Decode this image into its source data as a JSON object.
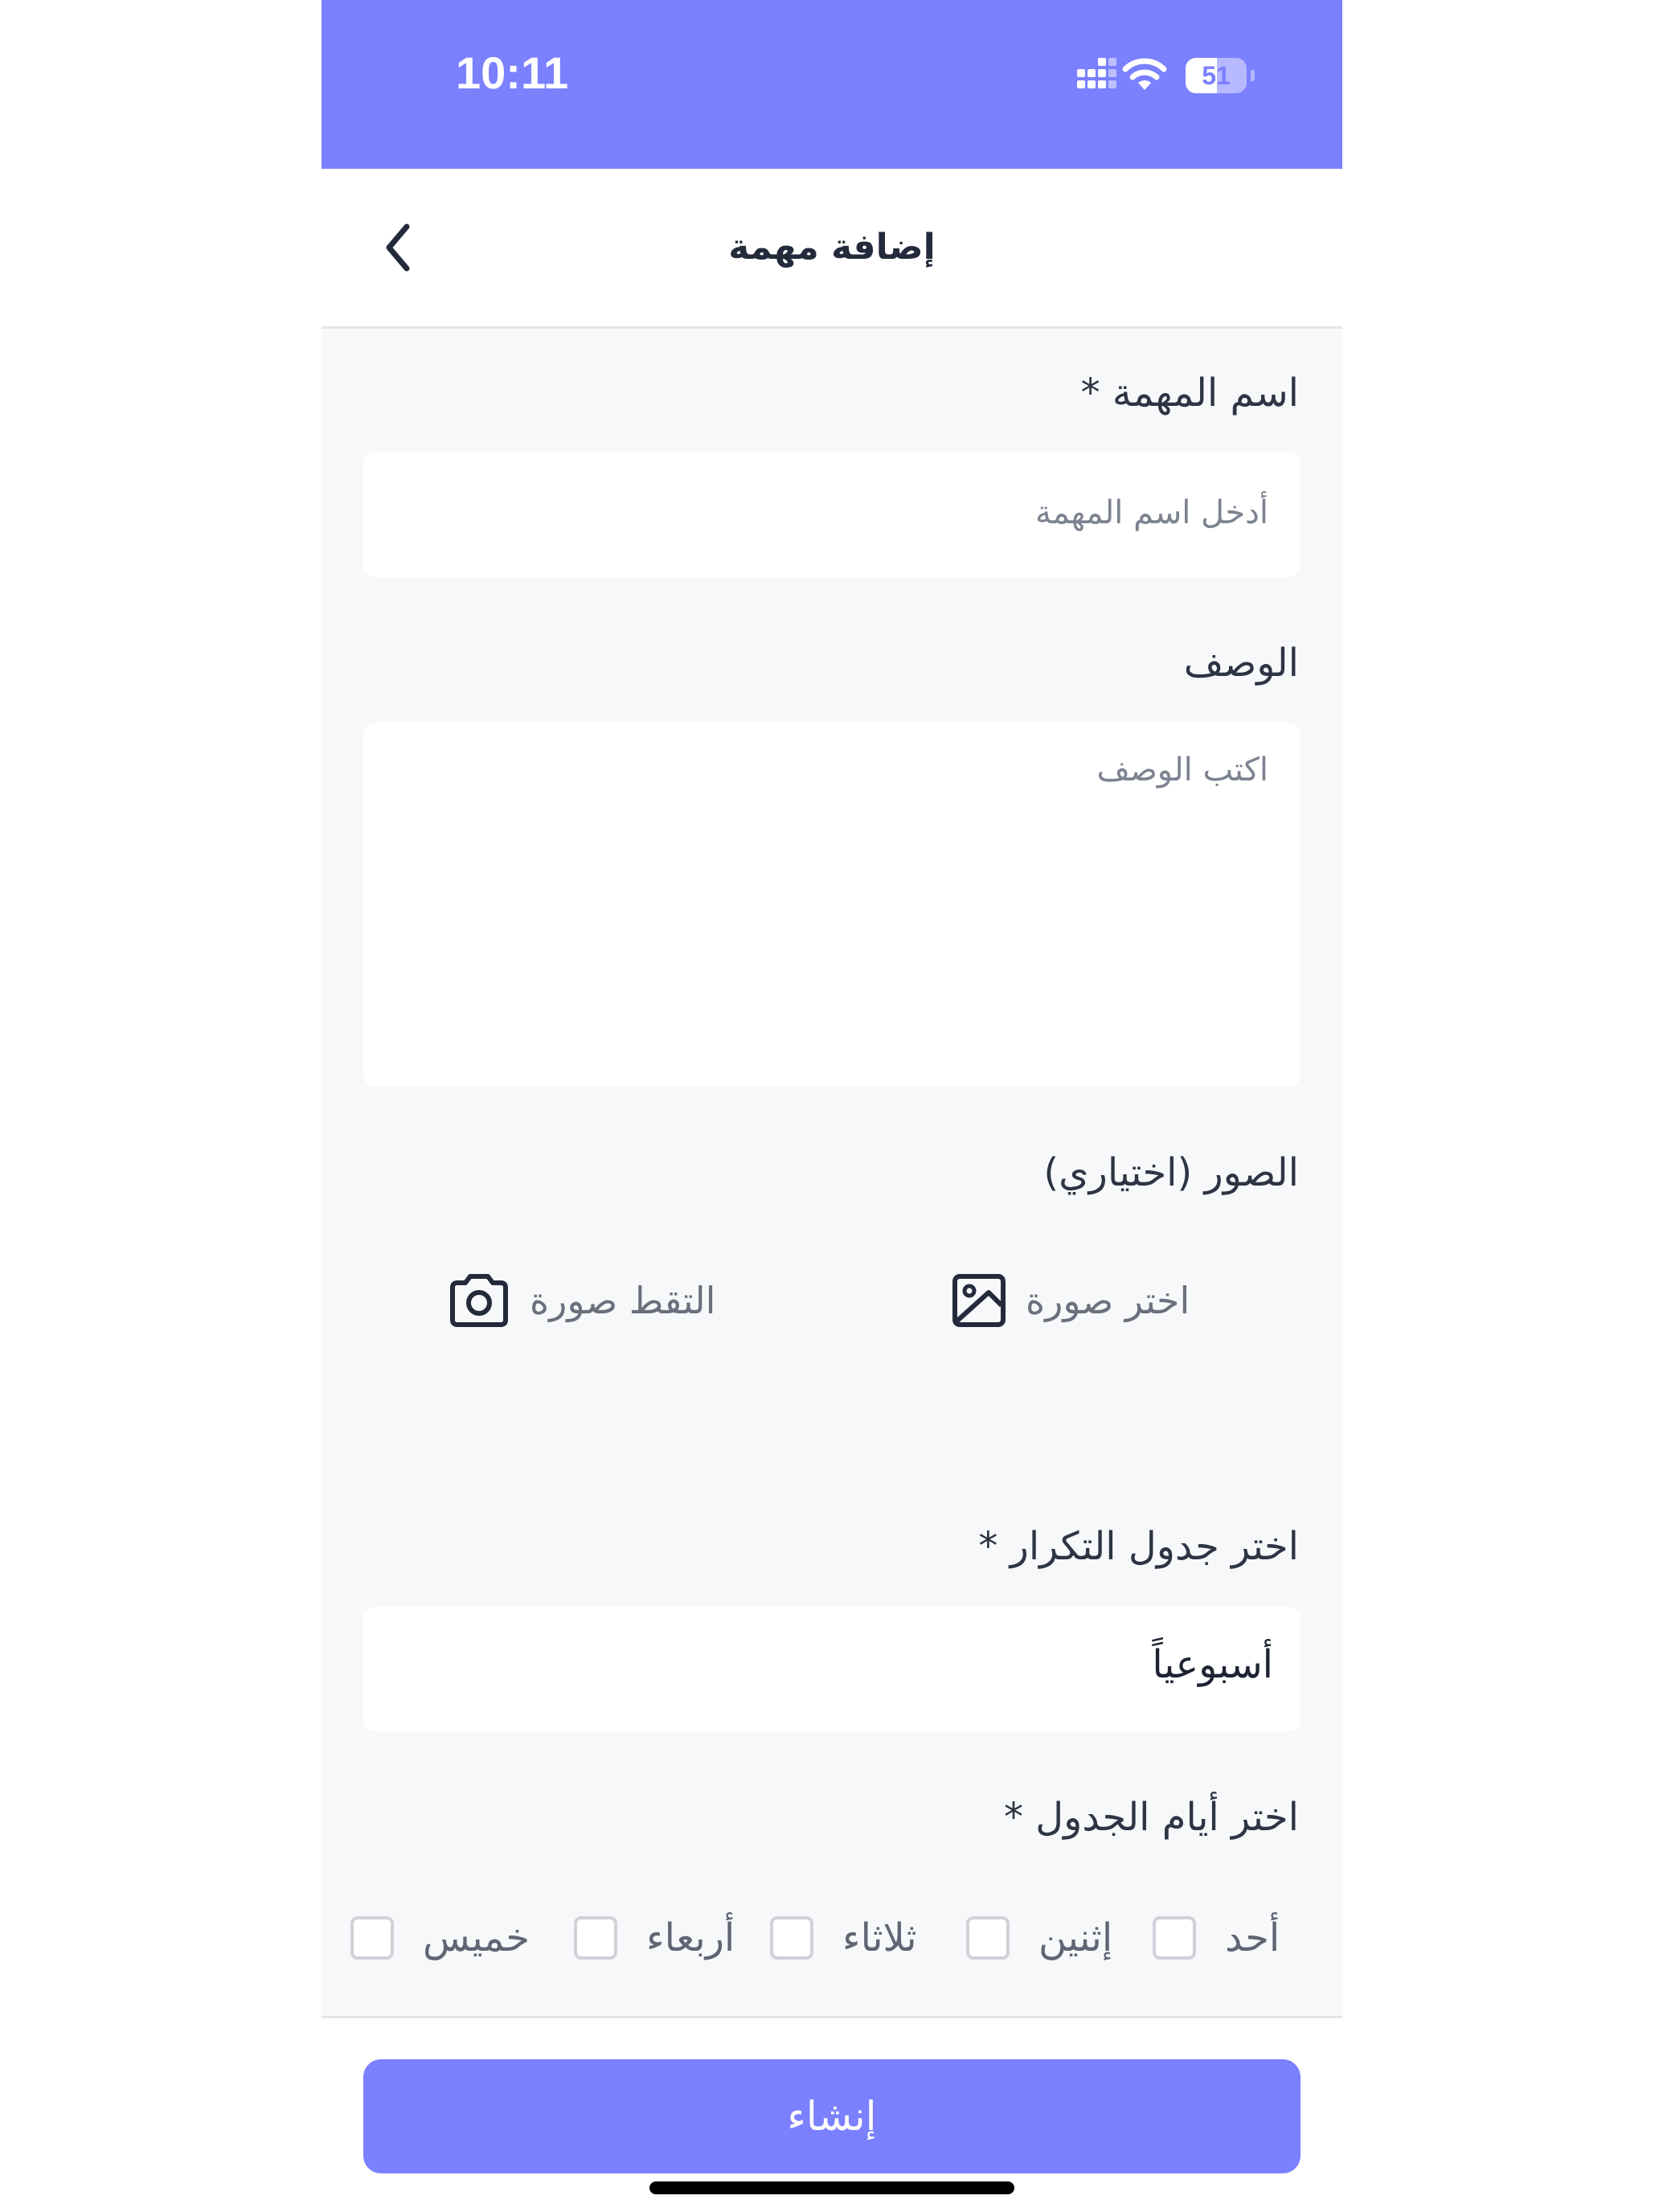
{
  "status_bar": {
    "time": "10:11",
    "battery_level": "51",
    "battery_fraction": 0.51,
    "background_color": "#7b80ff",
    "signal_icon": "cellular-signal-icon",
    "wifi_icon": "wifi-icon",
    "battery_icon": "battery-icon"
  },
  "header": {
    "title": "إضافة مهمة",
    "back_icon": "chevron-left-icon"
  },
  "form": {
    "task_name": {
      "label": "اسم المهمة *",
      "placeholder": "أدخل اسم المهمة",
      "value": ""
    },
    "description": {
      "label": "الوصف",
      "placeholder": "اكتب الوصف",
      "value": ""
    },
    "photos": {
      "label": "الصور (اختياري)",
      "choose_label": "اختر صورة",
      "choose_icon": "image-icon",
      "capture_label": "التقط صورة",
      "capture_icon": "camera-icon"
    },
    "repeat_schedule": {
      "label": "اختر جدول التكرار *",
      "selected": "أسبوعياً"
    },
    "schedule_days": {
      "label": "اختر أيام الجدول *",
      "days": [
        {
          "label": "أحد",
          "checked": false
        },
        {
          "label": "إثنين",
          "checked": false
        },
        {
          "label": "ثلاثاء",
          "checked": false
        },
        {
          "label": "أربعاء",
          "checked": false
        },
        {
          "label": "خميس",
          "checked": false
        }
      ]
    }
  },
  "footer": {
    "create_label": "إنشاء",
    "accent_color": "#7b80ff"
  }
}
